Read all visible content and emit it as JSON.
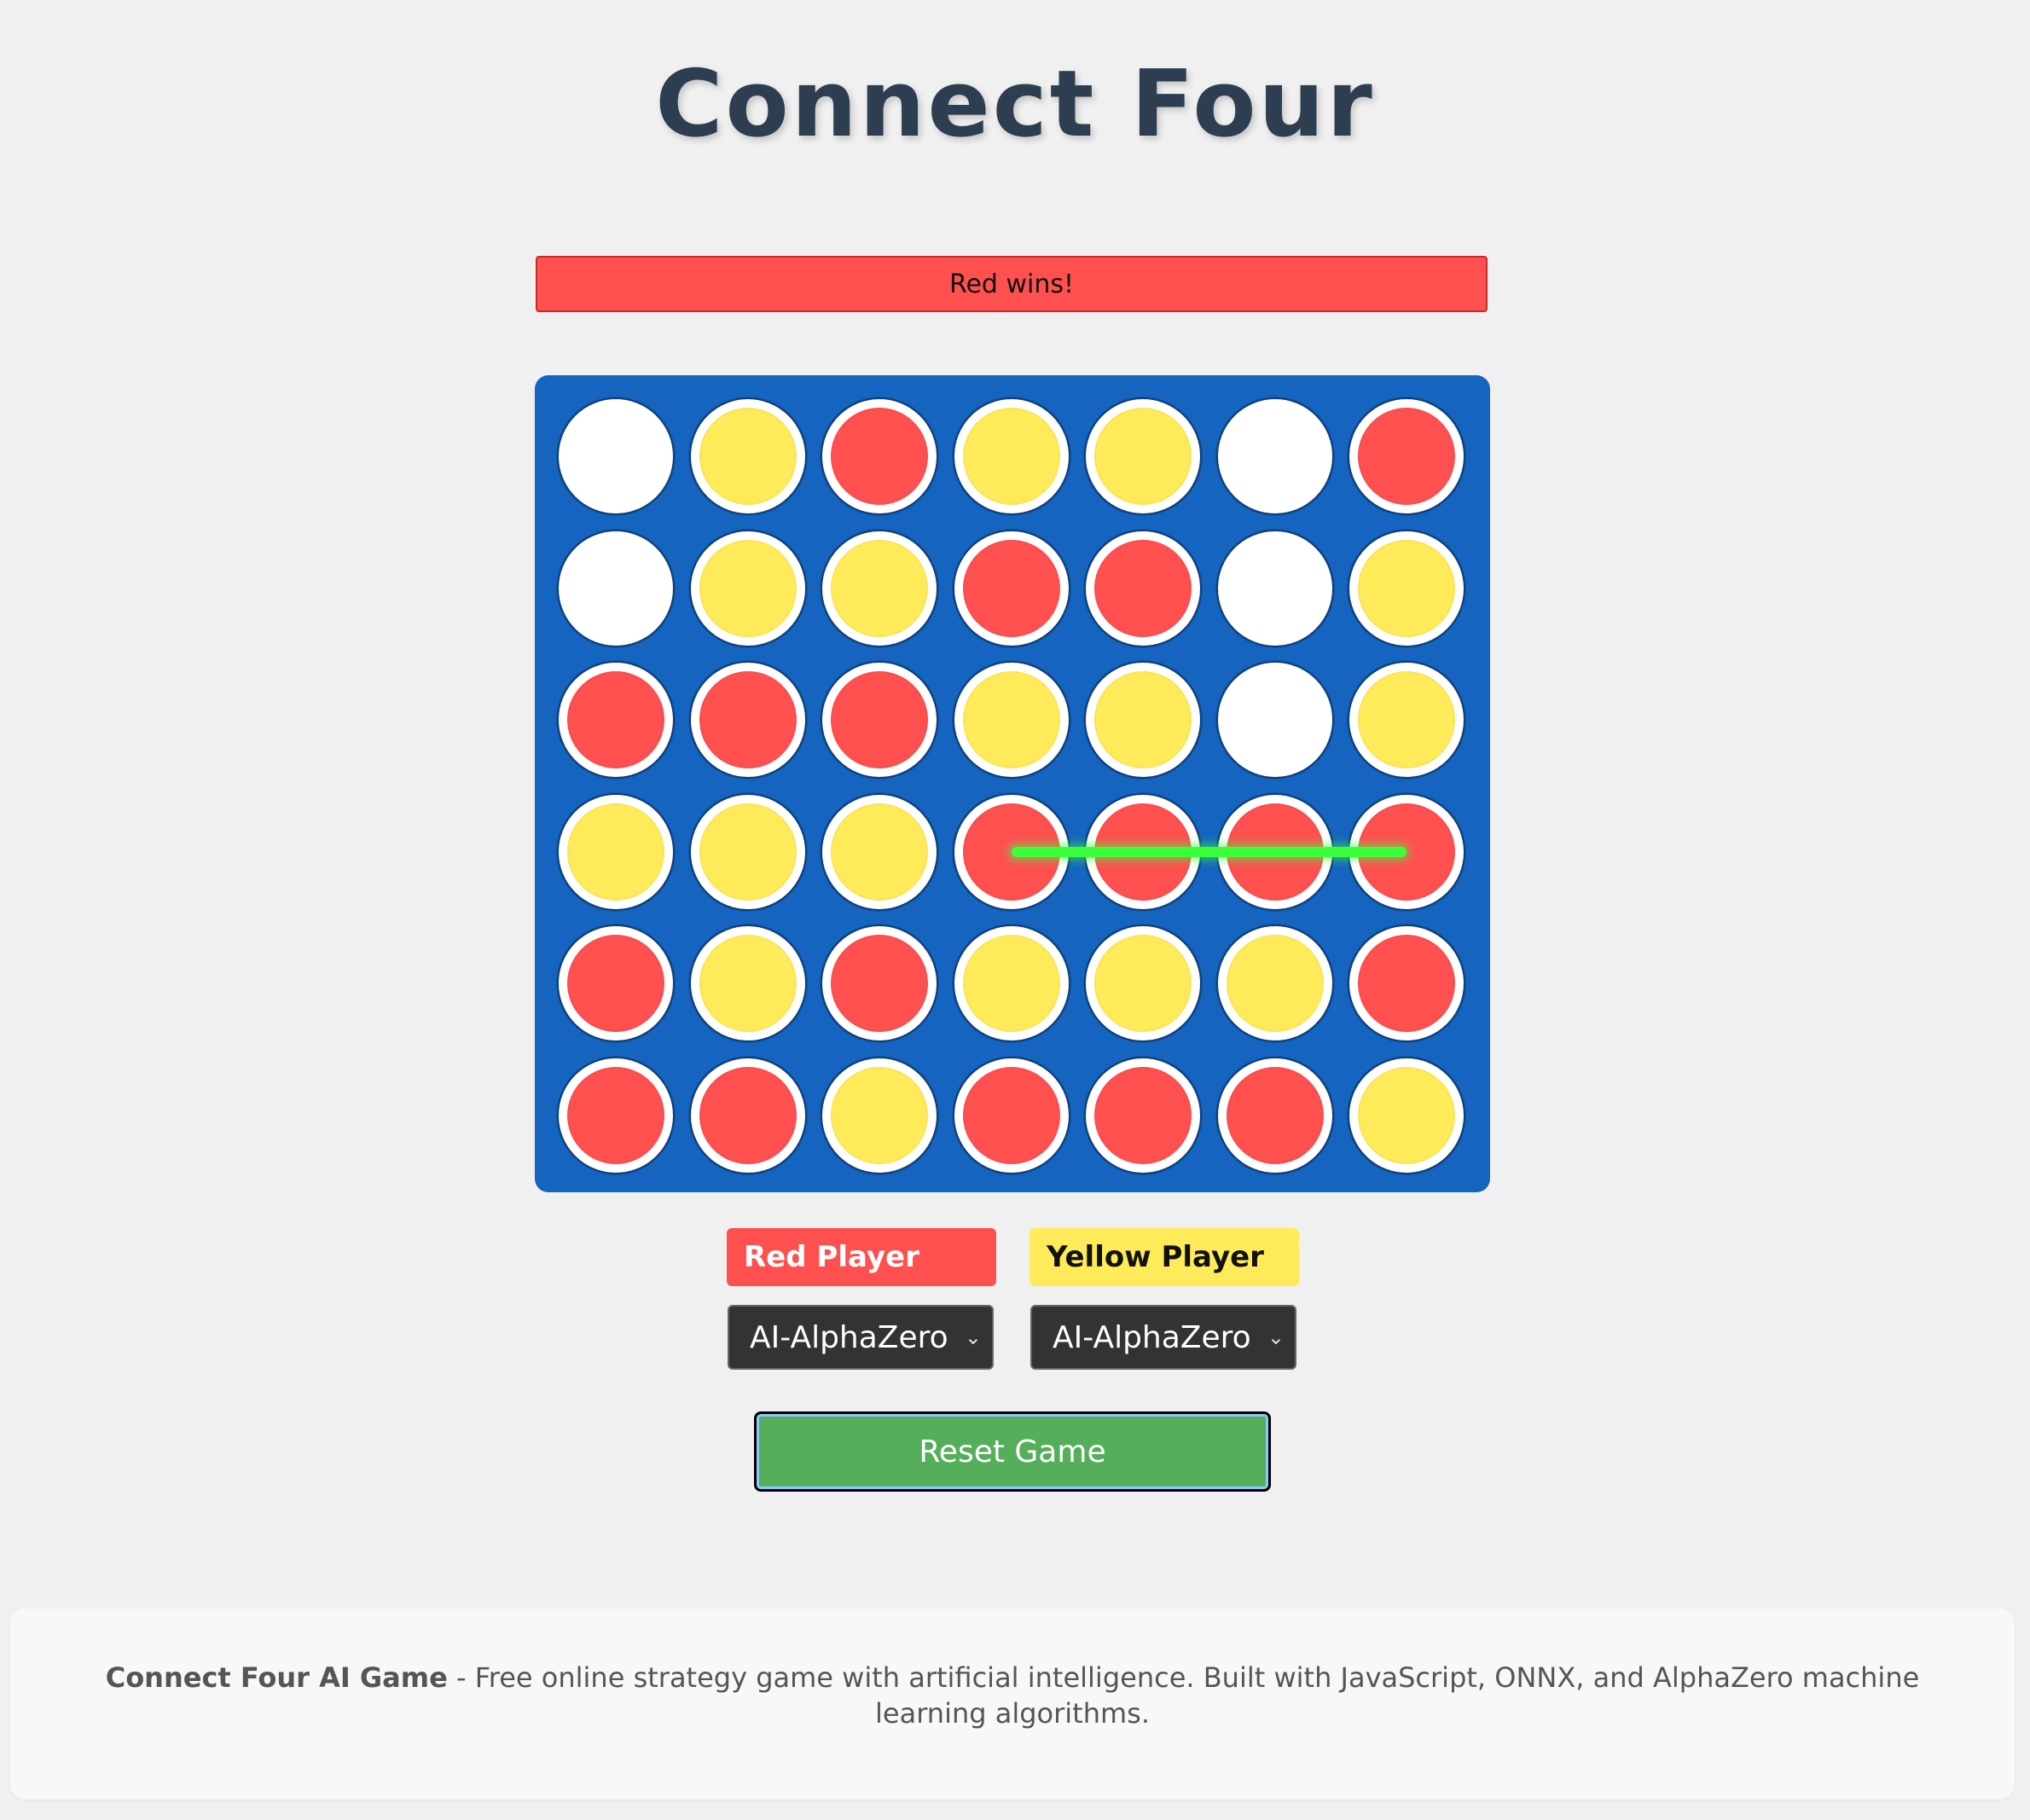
{
  "header": {
    "title": "Connect Four"
  },
  "status": {
    "text": "Red wins!"
  },
  "board": {
    "rows": [
      [
        "empty",
        "yellow",
        "red",
        "yellow",
        "yellow",
        "empty",
        "red"
      ],
      [
        "empty",
        "yellow",
        "yellow",
        "red",
        "red",
        "empty",
        "yellow"
      ],
      [
        "red",
        "red",
        "red",
        "yellow",
        "yellow",
        "empty",
        "yellow"
      ],
      [
        "yellow",
        "yellow",
        "yellow",
        "red",
        "red",
        "red",
        "red"
      ],
      [
        "red",
        "yellow",
        "red",
        "yellow",
        "yellow",
        "yellow",
        "red"
      ],
      [
        "red",
        "red",
        "yellow",
        "red",
        "red",
        "red",
        "yellow"
      ]
    ],
    "winning_line": {
      "row": 3,
      "from_col": 3,
      "to_col": 6
    },
    "colors": {
      "red": "#ff5050",
      "yellow": "#ffeb5a",
      "empty": "#ffffff",
      "board": "#1565c0",
      "win": "#3cff3c"
    }
  },
  "players": {
    "red": {
      "label": "Red Player",
      "selected": "AI-AlphaZero"
    },
    "yellow": {
      "label": "Yellow Player",
      "selected": "AI-AlphaZero"
    }
  },
  "controls": {
    "reset_label": "Reset Game"
  },
  "footer": {
    "bold": "Connect Four AI Game",
    "text": " - Free online strategy game with artificial intelligence. Built with JavaScript, ONNX, and AlphaZero machine learning algorithms."
  }
}
